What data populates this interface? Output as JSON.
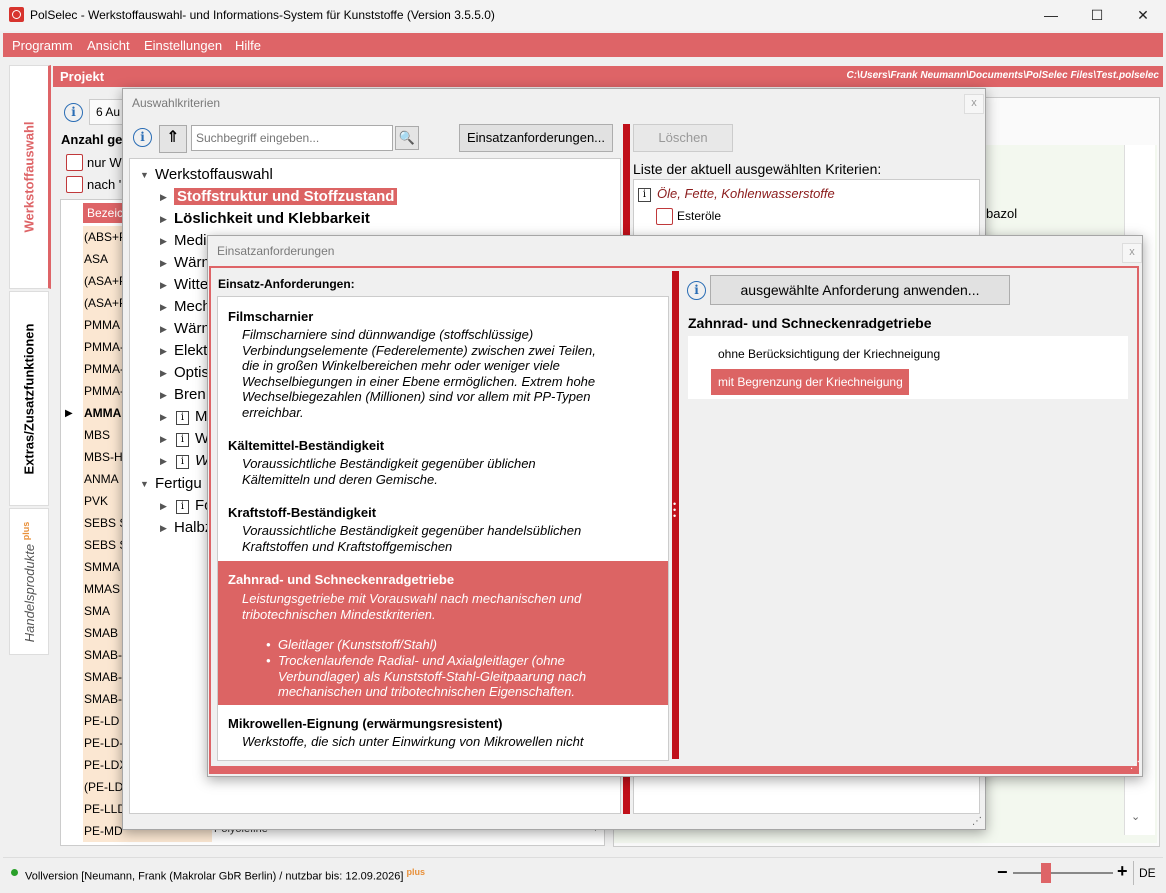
{
  "window": {
    "title": "PolSelec - Werkstoffauswahl- und Informations-System für Kunststoffe (Version 3.5.5.0)",
    "min": "—",
    "max": "☐",
    "close": "✕"
  },
  "menu": [
    "Programm",
    "Ansicht",
    "Einstellungen",
    "Hilfe"
  ],
  "vtabs": {
    "werkstoffauswahl": "Werkstoffauswahl",
    "extras": "Extras/Zusatzfunktionen",
    "handel": "Handelsprodukte",
    "handel_plus": "plus"
  },
  "project": {
    "label": "Projekt",
    "path": "C:\\Users\\Frank Neumann\\Documents\\PolSelec Files\\Test.polselec"
  },
  "main": {
    "count_field": "6 Au",
    "anzahl_label": "Anzahl ge",
    "opt1": "nur W",
    "opt2": "nach '",
    "col_header": "Bezeic",
    "rows": [
      "(ABS+P",
      "ASA",
      "(ASA+P",
      "(ASA+P",
      "PMMA",
      "PMMA-",
      "PMMA-",
      "PMMA-",
      "AMMA",
      "MBS",
      "MBS-HI",
      "ANMA",
      "PVK",
      "SEBS SI",
      "SEBS SI",
      "SMMA",
      "MMAS",
      "SMA",
      "SMAB",
      "SMAB-I",
      "SMAB-C",
      "SMAB-C",
      "PE-LD",
      "PE-LD-I",
      "PE-LDX",
      "(PE-LD-",
      "PE-LLD",
      "PE-MD"
    ],
    "last_row_group": "Polyolefine",
    "right_fragment": "bazol"
  },
  "auswahl": {
    "title": "Auswahlkriterien",
    "close": "x",
    "search_placeholder": "Suchbegriff eingeben...",
    "einsatz_button": "Einsatzanforderungen...",
    "loeschen_button": "Löschen",
    "liste_label": "Liste der aktuell ausgewählten Kriterien:",
    "tree_root": "Werkstoffauswahl",
    "tree_items": [
      "Stoffstruktur und Stoffzustand",
      "Löslichkeit und Klebbarkeit",
      "Medi",
      "Wärn",
      "Witte",
      "Mech",
      "Wärn",
      "Elektı",
      "Optis",
      "Brenı",
      "M",
      "W",
      "W"
    ],
    "tree_root2": "Fertigu",
    "tree_items2": [
      "Fo",
      "Halbz"
    ],
    "selected_group": "Öle, Fette, Kohlenwasserstoffe",
    "selected_item": "Esteröle"
  },
  "einsatz": {
    "title": "Einsatzanforderungen",
    "close": "x",
    "header": "Einsatz-Anforderungen:",
    "apply_button": "ausgewählte Anforderung anwenden...",
    "items": [
      {
        "title": "Filmscharnier",
        "desc": "Filmscharniere sind dünnwandige (stoffschlüssige) Verbindungselemente (Federelemente) zwischen zwei Teilen, die in großen Winkelbereichen mehr oder weniger viele Wechselbiegungen in einer Ebene ermöglichen. Extrem hohe Wechselbiegezahlen (Millionen) sind vor allem mit PP-Typen erreichbar."
      },
      {
        "title": "Kältemittel-Beständigkeit",
        "desc": "Voraussichtliche Beständigkeit gegenüber üblichen Kältemitteln und deren Gemische."
      },
      {
        "title": "Kraftstoff-Beständigkeit",
        "desc": "Voraussichtliche Beständigkeit gegenüber handelsüblichen Kraftstoffen und Kraftstoffgemischen"
      },
      {
        "title": "Zahnrad- und Schneckenradgetriebe",
        "desc": "Leistungsgetriebe mit Vorauswahl nach mechanischen und tribotechnischen Mindestkriterien.",
        "bullets": [
          "Gleitlager (Kunststoff/Stahl)",
          "Trockenlaufende Radial- und Axialgleitlager (ohne Verbundlager) als Kunststoff-Stahl-Gleitpaarung nach mechanischen und tribotechnischen Eigenschaften."
        ]
      },
      {
        "title": "Mikrowellen-Eignung (erwärmungsresistent)",
        "desc": "Werkstoffe, die sich unter Einwirkung von Mikrowellen nicht"
      }
    ],
    "detail_title": "Zahnrad- und Schneckenradgetriebe",
    "option1": "ohne Berücksichtigung der Kriechneigung",
    "option2": "mit Begrenzung der Kriechneigung"
  },
  "status": {
    "text": "Vollversion [Neumann, Frank (Makrolar GbR Berlin) / nutzbar bis: 12.09.2026]",
    "plus": "plus",
    "minus": "−",
    "plus_btn": "+",
    "lang": "DE"
  },
  "colors": {
    "accent": "#de6467",
    "highlight": "#dc6464",
    "dark_accent": "#c0101a"
  }
}
